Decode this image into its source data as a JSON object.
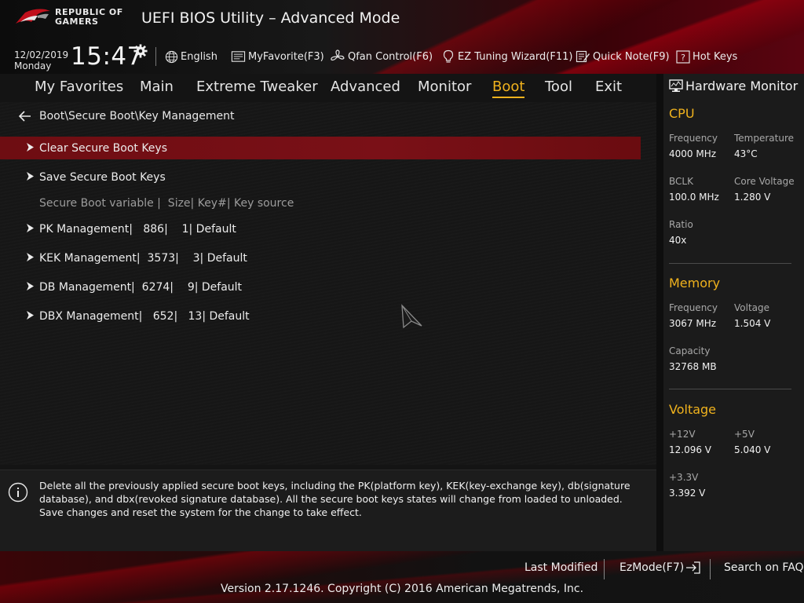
{
  "header": {
    "brand_line1": "REPUBLIC OF",
    "brand_line2": "GAMERS",
    "title": "UEFI BIOS Utility – Advanced Mode",
    "date": "12/02/2019",
    "day": "Monday",
    "time": "15:47",
    "buttons": {
      "language": "English",
      "myfavorite": "MyFavorite(F3)",
      "qfan": "Qfan Control(F6)",
      "ez_tuning": "EZ Tuning Wizard(F11)",
      "quick_note": "Quick Note(F9)",
      "hot_keys": "Hot Keys"
    }
  },
  "nav": {
    "active": "Boot",
    "items": [
      "My Favorites",
      "Main",
      "Extreme Tweaker",
      "Advanced",
      "Monitor",
      "Boot",
      "Tool",
      "Exit"
    ]
  },
  "main": {
    "breadcrumb": "Boot\\Secure Boot\\Key Management",
    "items": [
      {
        "label": "Clear Secure Boot Keys"
      },
      {
        "label": "Save Secure Boot Keys"
      }
    ],
    "column_header": "Secure Boot variable |  Size| Key#| Key source",
    "keys": [
      {
        "label": "PK Management|   886|    1| Default"
      },
      {
        "label": "KEK Management|  3573|    3| Default"
      },
      {
        "label": "DB Management|  6274|    9| Default"
      },
      {
        "label": "DBX Management|   652|   13| Default"
      }
    ]
  },
  "info": {
    "text": "Delete all the previously applied secure boot keys, including the PK(platform key),  KEK(key-exchange key), db(signature database), and dbx(revoked signature database). All the secure boot keys states will change from loaded to unloaded. Save changes and reset the system for the change to take effect."
  },
  "hardware_monitor": {
    "title": "Hardware Monitor",
    "cpu": {
      "title": "CPU",
      "frequency_label": "Frequency",
      "frequency": "4000 MHz",
      "temperature_label": "Temperature",
      "temperature": "43°C",
      "bclk_label": "BCLK",
      "bclk": "100.0 MHz",
      "core_voltage_label": "Core Voltage",
      "core_voltage": "1.280 V",
      "ratio_label": "Ratio",
      "ratio": "40x"
    },
    "memory": {
      "title": "Memory",
      "frequency_label": "Frequency",
      "frequency": "3067 MHz",
      "voltage_label": "Voltage",
      "voltage": "1.504 V",
      "capacity_label": "Capacity",
      "capacity": "32768 MB"
    },
    "voltage": {
      "title": "Voltage",
      "v12_label": "+12V",
      "v12": "12.096 V",
      "v5_label": "+5V",
      "v5": "5.040 V",
      "v33_label": "+3.3V",
      "v33": "3.392 V"
    }
  },
  "footer": {
    "last_modified": "Last Modified",
    "ezmode": "EzMode(F7)",
    "search_faq": "Search on FAQ",
    "copyright": "Version 2.17.1246. Copyright (C) 2016 American Megatrends, Inc."
  },
  "colors": {
    "accent": "#f0b21d",
    "selected_row": "#7a1017",
    "brand_red": "#c0101c"
  }
}
